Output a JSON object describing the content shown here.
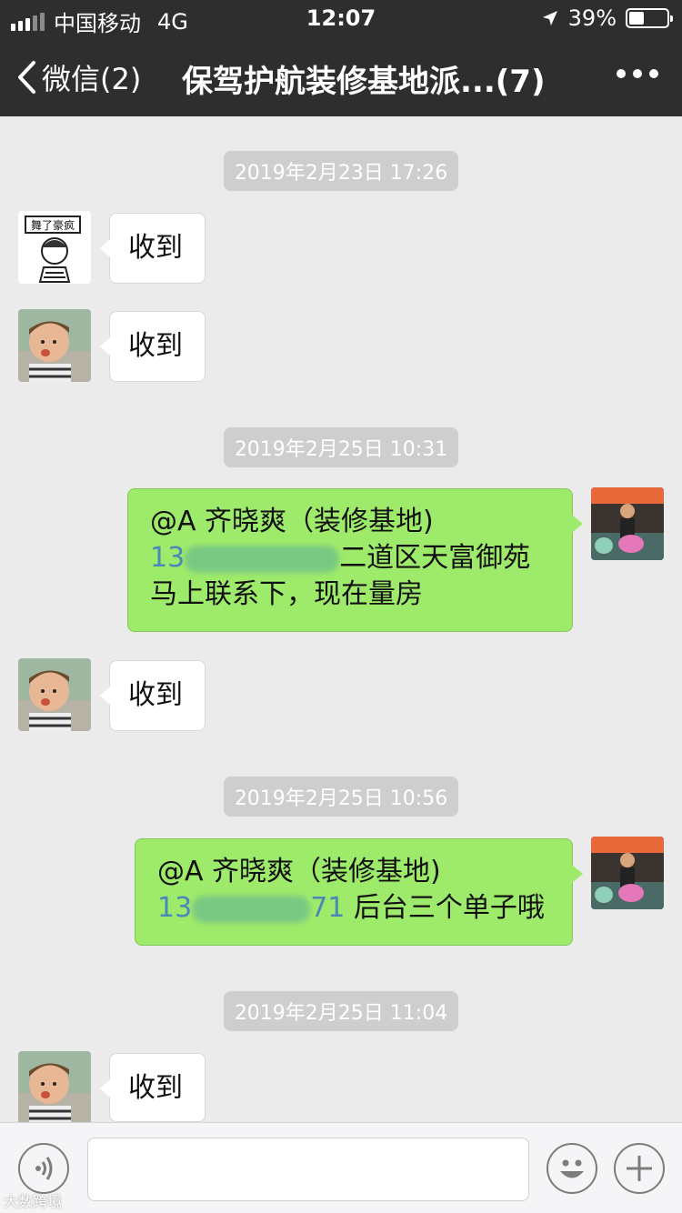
{
  "status": {
    "carrier": "中国移动",
    "network": "4G",
    "time": "12:07",
    "battery": "39%",
    "battery_level": 0.39
  },
  "nav": {
    "back_label": "微信(2)",
    "title": "保驾护航装修基地派...(7)"
  },
  "messages": {
    "ts1": "2019年2月23日 17:26",
    "m1": "收到",
    "m2": "收到",
    "ts2": "2019年2月25日 10:31",
    "m3_line1": "@A 齐晓爽（装修基地)",
    "m3_phone": "13",
    "m3_line2_rest": "二道区天富御苑",
    "m3_line3": "马上联系下，现在量房",
    "m4": "收到",
    "ts3": "2019年2月25日 10:56",
    "m5_line1": "@A 齐晓爽（装修基地)",
    "m5_phone_a": "13",
    "m5_phone_b": "71",
    "m5_line2_rest": "后台三个单子哦",
    "ts4": "2019年2月25日 11:04",
    "m6": "收到"
  },
  "watermark": "大数跨境"
}
